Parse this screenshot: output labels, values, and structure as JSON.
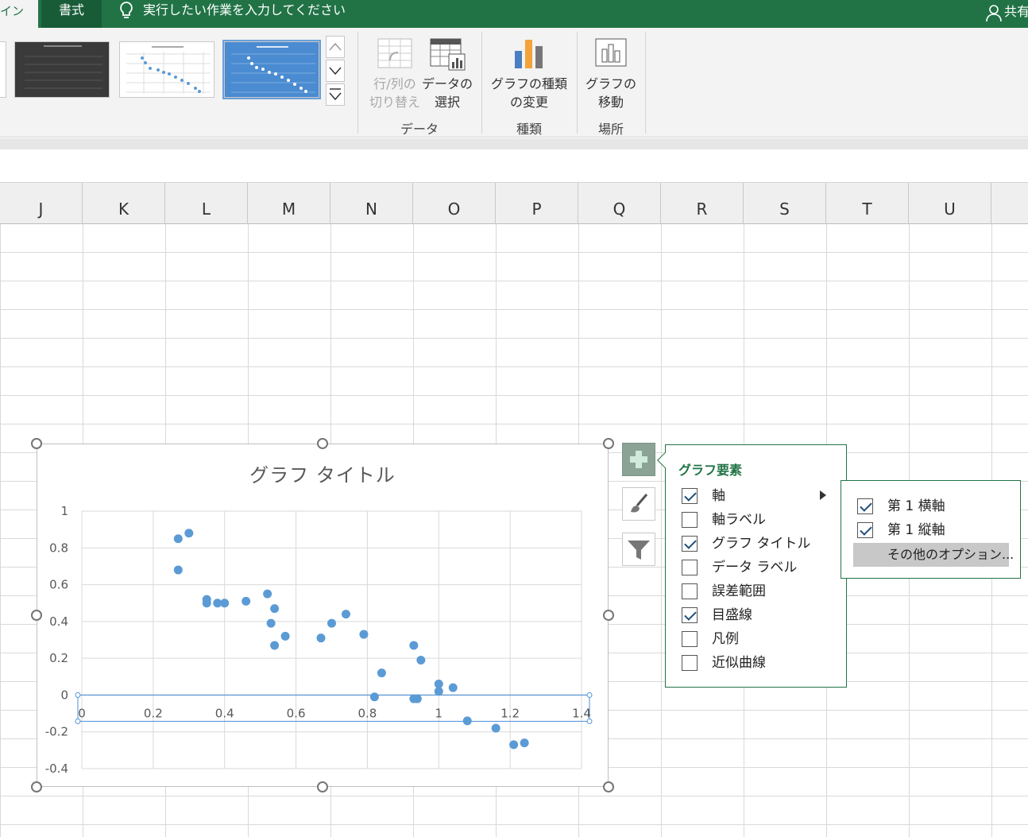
{
  "tabs": {
    "design_partial": "デザイン",
    "format": "書式"
  },
  "tellme": {
    "placeholder": "実行したい作業を入力してください"
  },
  "account": {
    "share": "共有"
  },
  "ribbon": {
    "switch_rowcol": "行/列の\n切り替え",
    "select_data": "データの\n選択",
    "change_type": "グラフの種類\nの変更",
    "move_chart": "グラフの\n移動",
    "group_data": "データ",
    "group_type": "種類",
    "group_location": "場所"
  },
  "columns": [
    "J",
    "K",
    "L",
    "M",
    "N",
    "O",
    "P",
    "Q",
    "R",
    "S",
    "T",
    "U"
  ],
  "chart_data": {
    "type": "scatter",
    "title": "グラフ タイトル",
    "xlim": [
      0,
      1.4
    ],
    "ylim": [
      -0.4,
      1
    ],
    "x_ticks": [
      "0",
      "0.2",
      "0.4",
      "0.6",
      "0.8",
      "1",
      "1.2",
      "1.4"
    ],
    "y_ticks": [
      "1",
      "0.8",
      "0.6",
      "0.4",
      "0.2",
      "0",
      "-0.2",
      "-0.4"
    ],
    "grid": true,
    "legend": false,
    "color": "#5b9bd5",
    "points": [
      [
        0.27,
        0.85
      ],
      [
        0.3,
        0.88
      ],
      [
        0.27,
        0.68
      ],
      [
        0.35,
        0.52
      ],
      [
        0.35,
        0.5
      ],
      [
        0.38,
        0.5
      ],
      [
        0.4,
        0.5
      ],
      [
        0.46,
        0.51
      ],
      [
        0.52,
        0.55
      ],
      [
        0.54,
        0.47
      ],
      [
        0.53,
        0.39
      ],
      [
        0.57,
        0.32
      ],
      [
        0.54,
        0.27
      ],
      [
        0.67,
        0.31
      ],
      [
        0.7,
        0.39
      ],
      [
        0.74,
        0.44
      ],
      [
        0.79,
        0.33
      ],
      [
        0.84,
        0.12
      ],
      [
        0.82,
        -0.01
      ],
      [
        0.93,
        0.27
      ],
      [
        0.95,
        0.19
      ],
      [
        0.94,
        -0.02
      ],
      [
        0.93,
        -0.02
      ],
      [
        1.0,
        0.06
      ],
      [
        1.0,
        0.02
      ],
      [
        1.04,
        0.04
      ],
      [
        1.08,
        -0.14
      ],
      [
        1.16,
        -0.18
      ],
      [
        1.21,
        -0.27
      ],
      [
        1.24,
        -0.26
      ]
    ]
  },
  "chart_elements": {
    "title": "グラフ要素",
    "items": [
      {
        "label": "軸",
        "checked": true
      },
      {
        "label": "軸ラベル",
        "checked": false
      },
      {
        "label": "グラフ タイトル",
        "checked": true
      },
      {
        "label": "データ ラベル",
        "checked": false
      },
      {
        "label": "誤差範囲",
        "checked": false
      },
      {
        "label": "目盛線",
        "checked": true
      },
      {
        "label": "凡例",
        "checked": false
      },
      {
        "label": "近似曲線",
        "checked": false
      }
    ]
  },
  "axis_submenu": {
    "primary_horizontal": "第 1 横軸",
    "primary_vertical": "第 1 縦軸",
    "more_options": "その他のオプション..."
  }
}
